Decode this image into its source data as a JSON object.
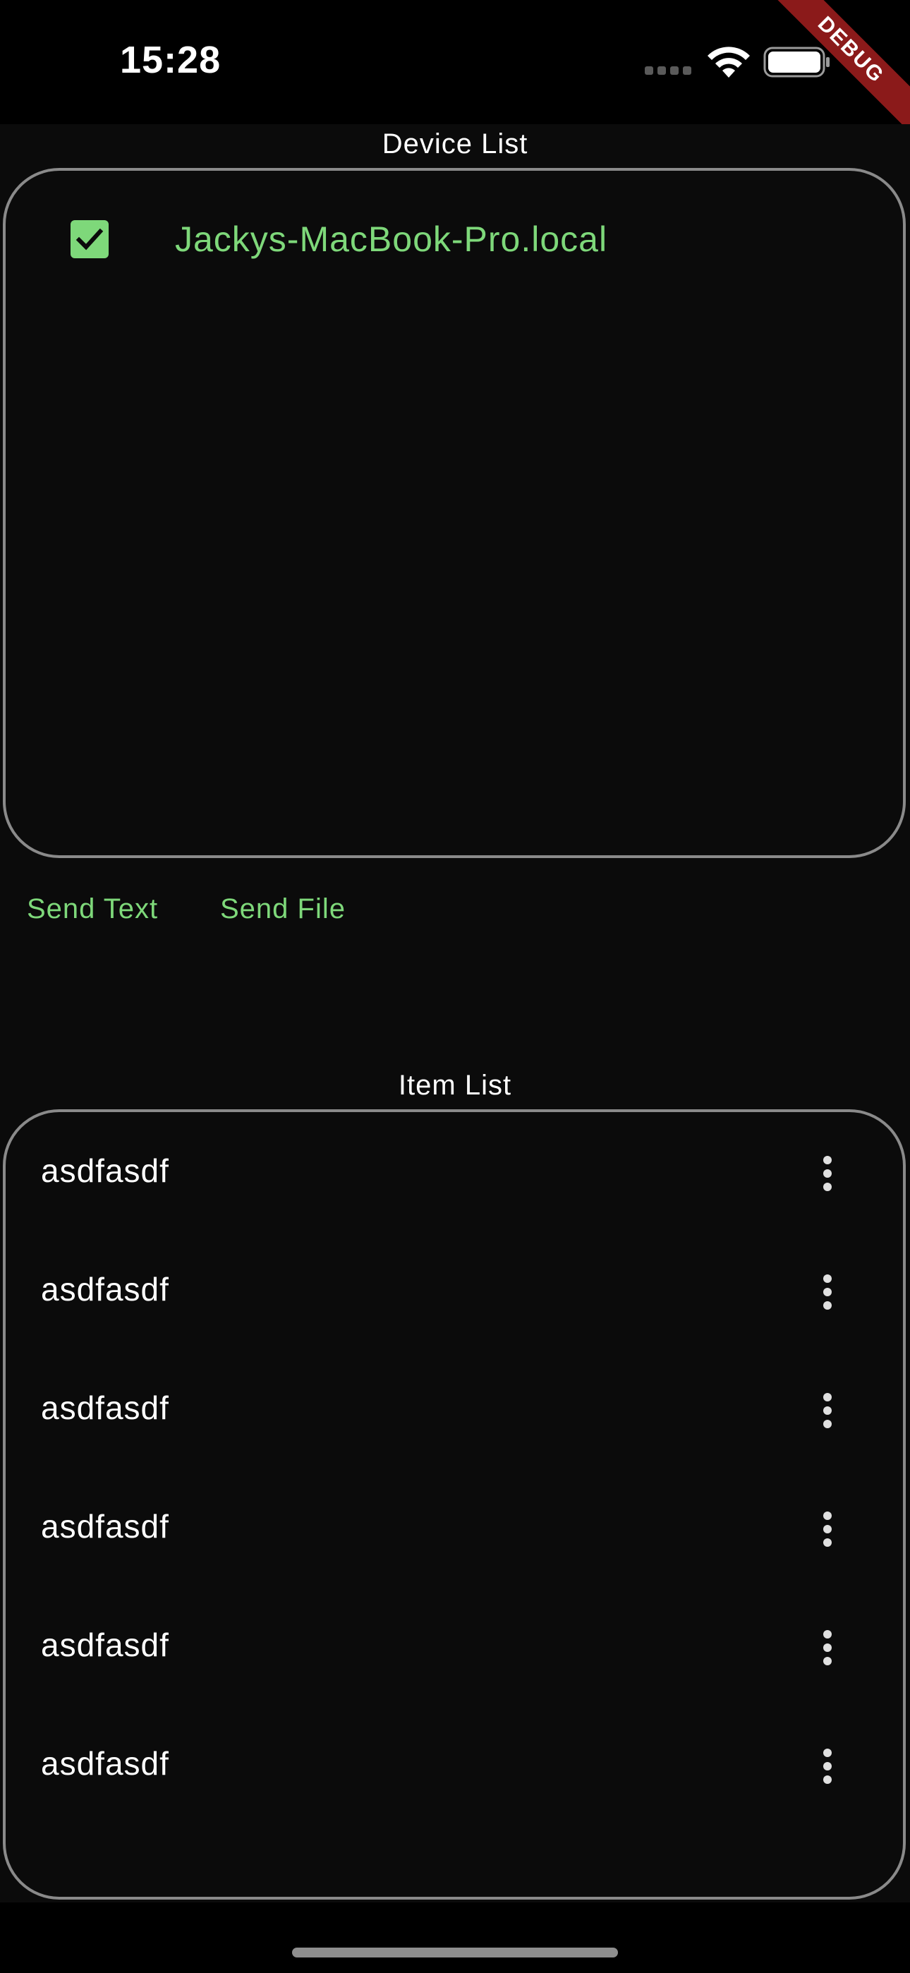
{
  "status_bar": {
    "time": "15:28",
    "debug_label": "DEBUG"
  },
  "device_list": {
    "title": "Device List",
    "devices": [
      {
        "name": "Jackys-MacBook-Pro.local",
        "checked": true
      }
    ]
  },
  "actions": {
    "send_text": "Send Text",
    "send_file": "Send File"
  },
  "item_list": {
    "title": "Item List",
    "items": [
      {
        "label": "asdfasdf"
      },
      {
        "label": "asdfasdf"
      },
      {
        "label": "asdfasdf"
      },
      {
        "label": "asdfasdf"
      },
      {
        "label": "asdfasdf"
      },
      {
        "label": "asdfasdf"
      }
    ]
  },
  "icons": {
    "checkbox": "check-icon",
    "item_menu": "more-vertical-icon",
    "signal": "cellular-signal-icon",
    "wifi": "wifi-icon",
    "battery": "battery-icon"
  },
  "colors": {
    "accent": "#7ed87a",
    "background": "#0b0b0b",
    "panel_border": "#8a8a8a",
    "debug_banner": "#8b1a1a"
  }
}
